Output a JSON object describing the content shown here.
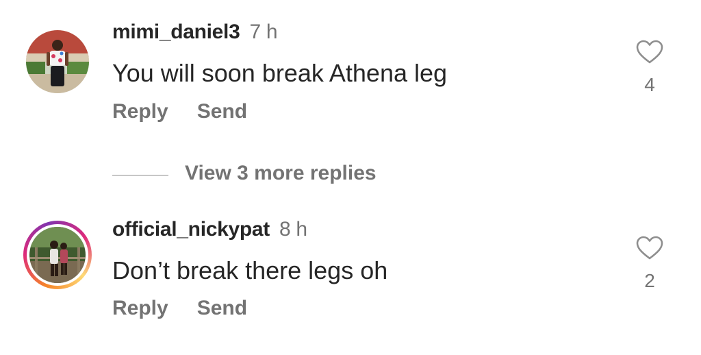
{
  "comments": [
    {
      "username": "mimi_daniel3",
      "time": "7 h",
      "text": "You will soon break Athena leg",
      "reply_label": "Reply",
      "send_label": "Send",
      "likes": "4",
      "like_icon": "heart-outline-icon",
      "has_story": false
    },
    {
      "username": "official_nickypat",
      "time": "8 h",
      "text": "Don’t break there legs oh",
      "reply_label": "Reply",
      "send_label": "Send",
      "likes": "2",
      "like_icon": "heart-outline-icon",
      "has_story": true
    }
  ],
  "view_replies": {
    "label": "View 3 more replies"
  },
  "colors": {
    "primary_text": "#262626",
    "secondary_text": "#737373",
    "divider": "#c7c7c7",
    "story_ring": [
      "#f58529",
      "#dd2a7b",
      "#8134af",
      "#feda77"
    ]
  }
}
